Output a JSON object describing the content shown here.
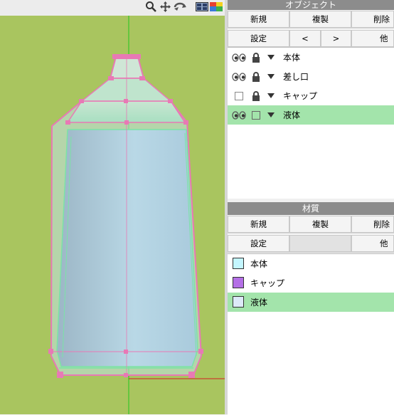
{
  "objects_panel": {
    "title": "オブジェクト",
    "buttons_row1": [
      "新規",
      "複製",
      "削除"
    ],
    "buttons_row2": [
      "設定",
      "<",
      ">",
      "他"
    ],
    "items": [
      {
        "name": "本体",
        "visibility": "eye-icon",
        "lock": "lock-icon",
        "selected": false
      },
      {
        "name": "差し口",
        "visibility": "eye-icon",
        "lock": "lock-icon",
        "selected": false
      },
      {
        "name": "キャップ",
        "visibility": "hidden-checkbox",
        "lock": "lock-icon",
        "selected": false
      },
      {
        "name": "液体",
        "visibility": "eye-icon",
        "lock": "unlocked-checkbox",
        "selected": true
      }
    ]
  },
  "materials_panel": {
    "title": "材質",
    "buttons_row1": [
      "新規",
      "複製",
      "削除"
    ],
    "buttons_row2": [
      "設定",
      "",
      "他"
    ],
    "items": [
      {
        "name": "本体",
        "color": "#c4f6ff",
        "selected": false
      },
      {
        "name": "キャップ",
        "color": "#b46fe6",
        "selected": false
      },
      {
        "name": "液体",
        "color": "#dde9f8",
        "selected": true
      }
    ]
  },
  "colors": {
    "viewport_bg": "#a9c55f",
    "selection": "#a3e4ab",
    "wire_pink": "#e879b5",
    "wire_green": "#7be3a6"
  }
}
